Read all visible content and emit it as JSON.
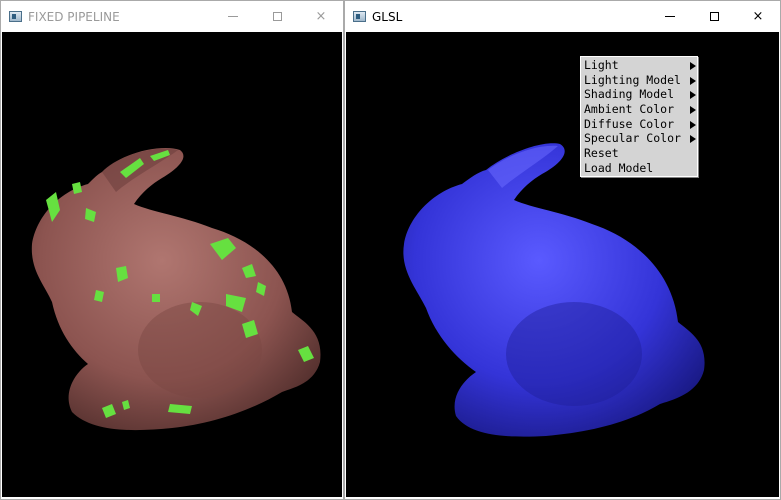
{
  "windows": [
    {
      "title": "FIXED PIPELINE",
      "icon": "app-icon",
      "active": false,
      "render": {
        "model": "bunny",
        "surface_color": "#8c5450",
        "highlight_color": "#66e040"
      }
    },
    {
      "title": "GLSL",
      "icon": "app-icon",
      "active": true,
      "render": {
        "model": "bunny",
        "surface_color": "#3a3ae0"
      },
      "context_menu": {
        "items": [
          {
            "label": "Light",
            "submenu": true
          },
          {
            "label": "Lighting Model",
            "submenu": true
          },
          {
            "label": "Shading Model",
            "submenu": true
          },
          {
            "label": "Ambient Color",
            "submenu": true
          },
          {
            "label": "Diffuse Color",
            "submenu": true
          },
          {
            "label": "Specular Color",
            "submenu": true
          },
          {
            "label": "Reset",
            "submenu": false
          },
          {
            "label": "Load Model",
            "submenu": false
          }
        ]
      }
    }
  ],
  "window_controls": {
    "minimize": "minimize-icon",
    "maximize": "maximize-icon",
    "close": "×"
  }
}
